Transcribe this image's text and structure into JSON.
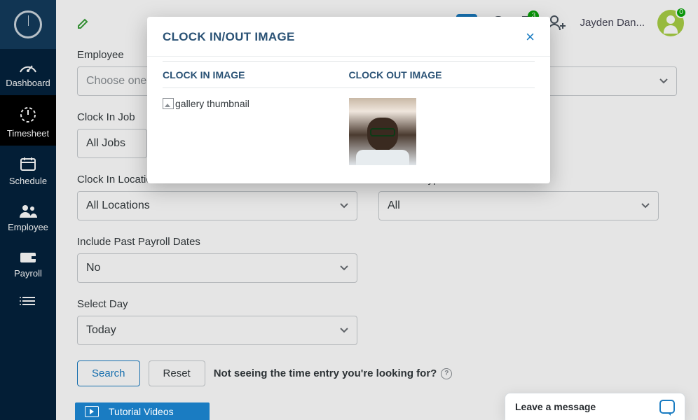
{
  "sidebar": {
    "items": [
      {
        "label": "Dashboard"
      },
      {
        "label": "Timesheet"
      },
      {
        "label": "Schedule"
      },
      {
        "label": "Employee"
      },
      {
        "label": "Payroll"
      }
    ]
  },
  "topbar": {
    "user_name": "Jayden Dan...",
    "notification_count": "3",
    "avatar_badge": "0"
  },
  "form": {
    "employee": {
      "label": "Employee",
      "value": "Choose one"
    },
    "clock_in_job": {
      "label": "Clock In Job",
      "value": "All Jobs"
    },
    "clock_in_location": {
      "label": "Clock In Location",
      "value": "All Locations"
    },
    "absence_type": {
      "label": "Absence Type",
      "value": "All"
    },
    "include_past": {
      "label": "Include Past Payroll Dates",
      "value": "No"
    },
    "select_day": {
      "label": "Select Day",
      "value": "Today"
    },
    "search_button": "Search",
    "reset_button": "Reset",
    "hint": "Not seeing the time entry you're looking for?"
  },
  "modal": {
    "title": "CLOCK IN/OUT IMAGE",
    "col_in": "CLOCK IN IMAGE",
    "col_out": "CLOCK OUT IMAGE",
    "broken_alt": "gallery thumbnail"
  },
  "tutorial": {
    "label": "Tutorial Videos"
  },
  "chat": {
    "label": "Leave a message"
  }
}
